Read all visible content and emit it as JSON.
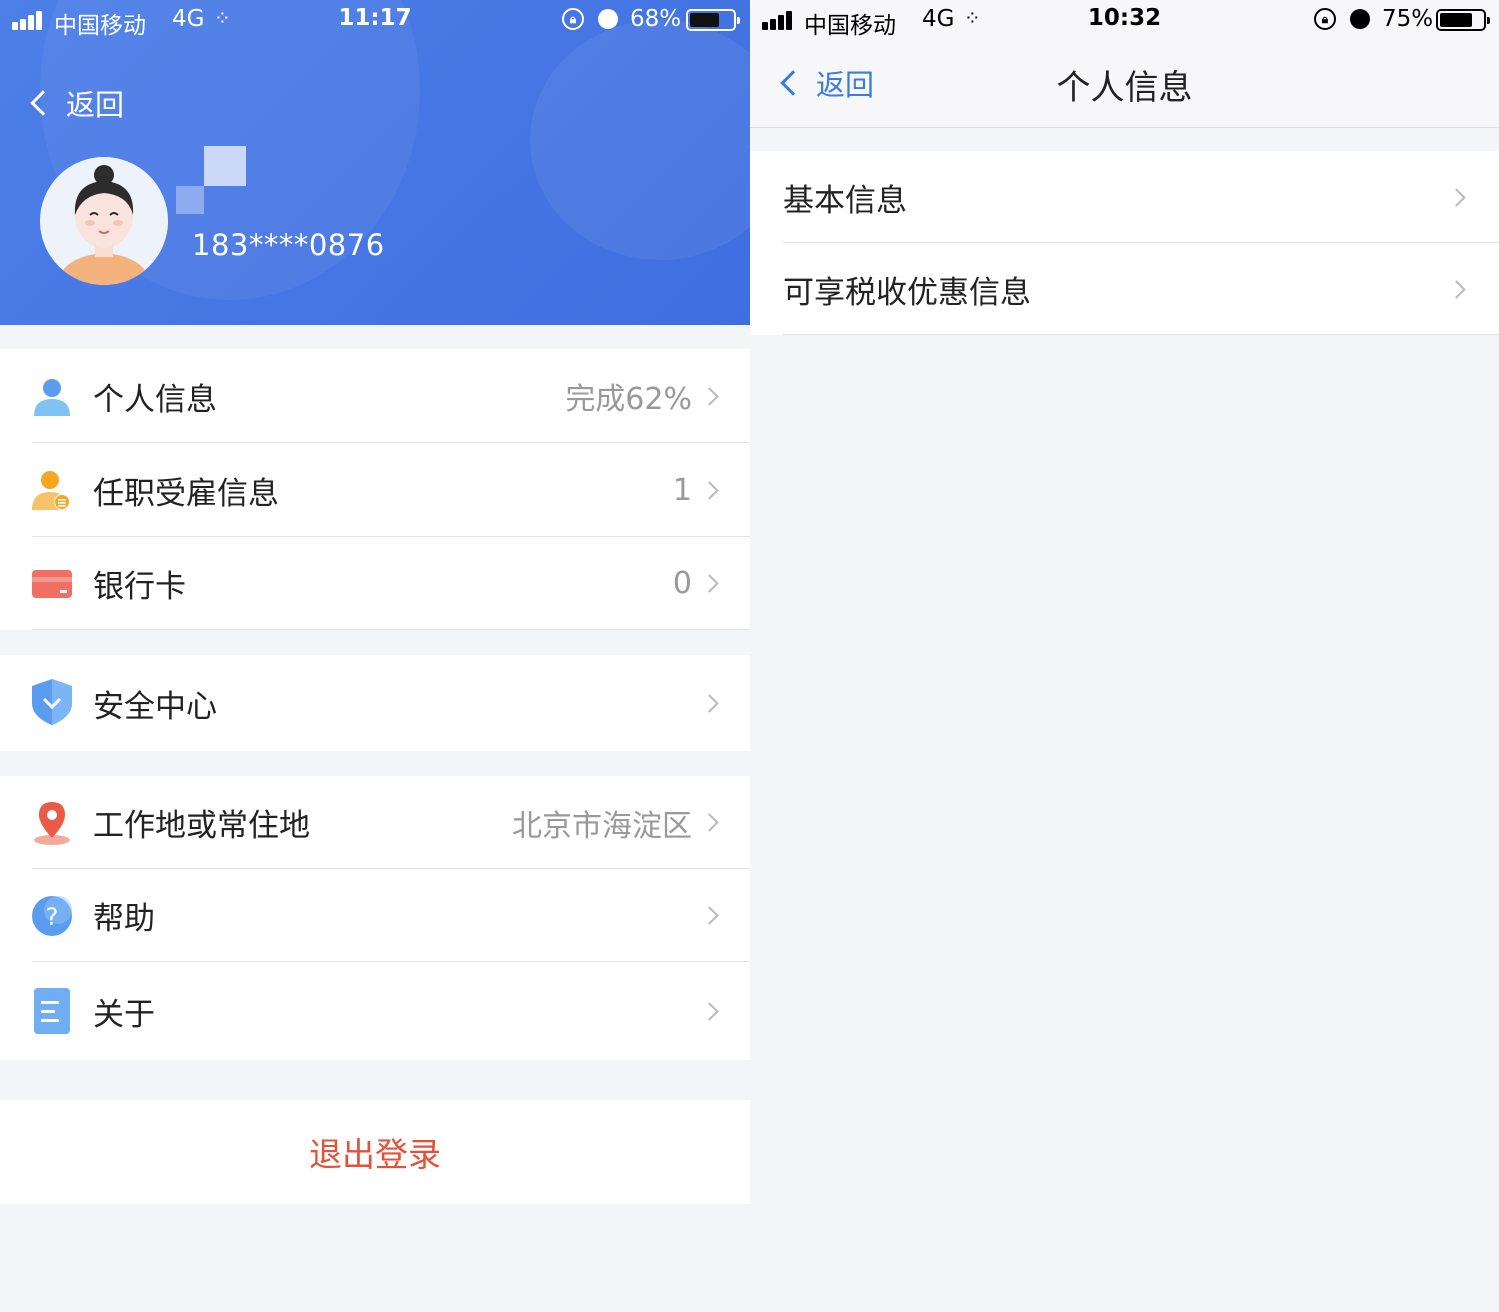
{
  "left": {
    "status": {
      "carrier": "中国移动",
      "network": "4G",
      "time": "11:17",
      "battery": "68%",
      "battery_level": 0.68
    },
    "back_label": "返回",
    "phone": "183****0876",
    "group1": [
      {
        "label": "个人信息",
        "value": "完成62%",
        "icon": "person-icon"
      },
      {
        "label": "任职受雇信息",
        "value": "1",
        "icon": "employment-icon"
      },
      {
        "label": "银行卡",
        "value": "0",
        "icon": "bank-card-icon"
      }
    ],
    "group2": [
      {
        "label": "安全中心",
        "value": "",
        "icon": "shield-icon"
      }
    ],
    "group3": [
      {
        "label": "工作地或常住地",
        "value": "北京市海淀区",
        "icon": "location-pin-icon"
      },
      {
        "label": "帮助",
        "value": "",
        "icon": "help-icon"
      },
      {
        "label": "关于",
        "value": "",
        "icon": "document-icon"
      }
    ],
    "logout_label": "退出登录",
    "colors": {
      "header_blue": "#4478e4",
      "logout_red": "#e0533a"
    }
  },
  "right": {
    "status": {
      "carrier": "中国移动",
      "network": "4G",
      "time": "10:32",
      "battery": "75%",
      "battery_level": 0.75
    },
    "back_label": "返回",
    "title": "个人信息",
    "items": [
      {
        "label": "基本信息"
      },
      {
        "label": "可享税收优惠信息"
      }
    ],
    "colors": {
      "link_blue": "#3a7be0"
    }
  }
}
